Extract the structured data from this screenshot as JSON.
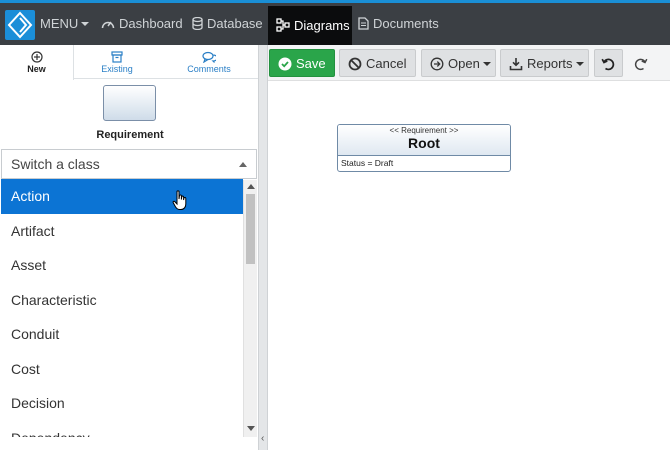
{
  "nav": {
    "menu_label": "MENU",
    "items": [
      {
        "label": "Dashboard",
        "icon": "gauge-icon"
      },
      {
        "label": "Database",
        "icon": "database-icon"
      },
      {
        "label": "Diagrams",
        "icon": "diagram-icon",
        "active": true
      },
      {
        "label": "Documents",
        "icon": "document-icon"
      }
    ],
    "accent_color": "#1a8fd6",
    "bar_color": "#3b3f44"
  },
  "left_panel": {
    "tabs": [
      {
        "label": "New",
        "icon": "plus-circle-icon",
        "active": true
      },
      {
        "label": "Existing",
        "icon": "archive-icon"
      },
      {
        "label": "Comments",
        "icon": "comments-icon"
      }
    ],
    "shape_label": "Requirement",
    "class_select": {
      "value": "Switch a class"
    },
    "class_list": [
      "Action",
      "Artifact",
      "Asset",
      "Characteristic",
      "Conduit",
      "Cost",
      "Decision",
      "Dependency"
    ],
    "active_item": "Action",
    "active_color": "#0c74d4"
  },
  "toolbar": {
    "save_label": "Save",
    "cancel_label": "Cancel",
    "open_label": "Open",
    "reports_label": "Reports",
    "save_color": "#2aa54a"
  },
  "canvas": {
    "node": {
      "stereotype": "<< Requirement >>",
      "name": "Root",
      "attribute": "Status = Draft"
    }
  }
}
